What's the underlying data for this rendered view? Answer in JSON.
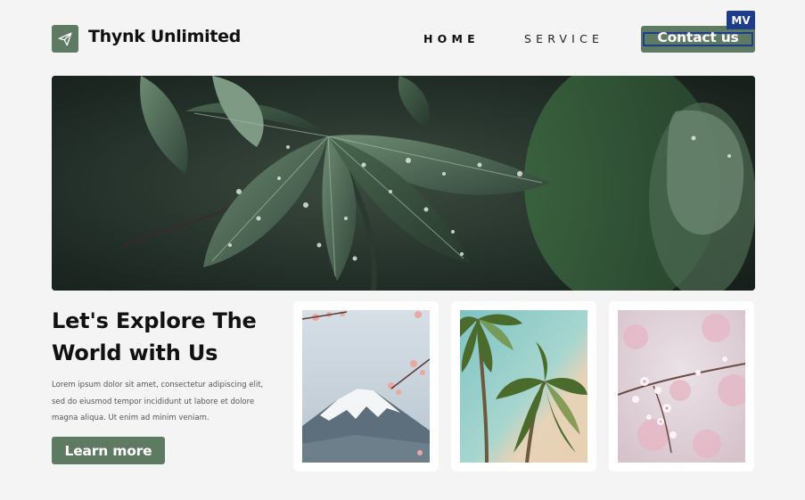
{
  "header": {
    "brand": "Thynk Unlimited",
    "logo_icon": "paper-plane-icon",
    "nav": [
      {
        "label": "HOME",
        "active": true
      },
      {
        "label": "SERVICE",
        "active": false
      }
    ],
    "contact_label": "Contact us",
    "badge": "MV"
  },
  "hero": {
    "image": "rain-soaked-green-leaves-photo"
  },
  "intro": {
    "headline_line1": "Let's Explore The",
    "headline_line2": "World with Us",
    "body": "Lorem ipsum dolor sit amet, consectetur adipiscing elit, sed do eiusmod tempor incididunt ut labore et dolore magna aliqua. Ut enim ad minim veniam.",
    "cta_label": "Learn more"
  },
  "gallery": [
    {
      "image": "mount-fuji-cherry-blossom-photo"
    },
    {
      "image": "palm-trees-beach-photo"
    },
    {
      "image": "pink-cherry-blossom-photo"
    }
  ],
  "colors": {
    "accent": "#5f7a63",
    "badge": "#1e3c8c",
    "background": "#f4f4f4"
  }
}
